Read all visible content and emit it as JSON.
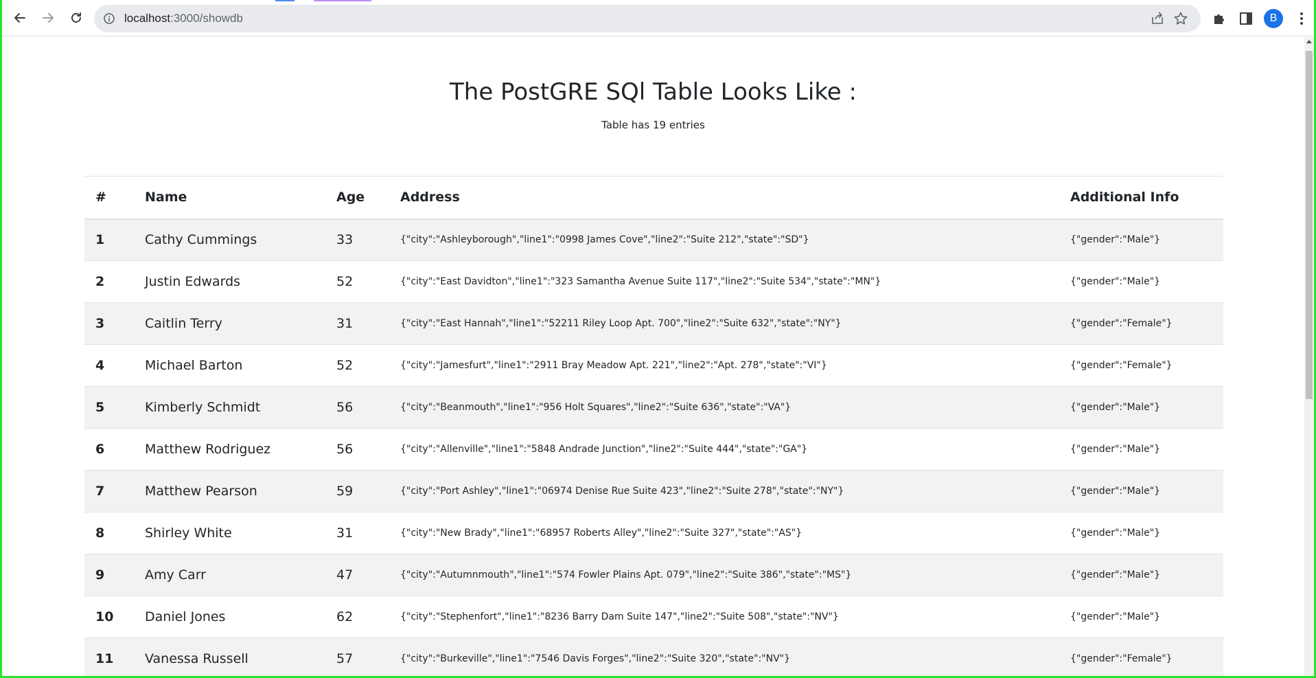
{
  "browser": {
    "url_host": "localhost",
    "url_path": ":3000/showdb",
    "avatar_letter": "B"
  },
  "page": {
    "title": "The PostGRE SQl Table Looks Like :",
    "subtitle": "Table has 19 entries"
  },
  "table": {
    "headers": [
      "#",
      "Name",
      "Age",
      "Address",
      "Additional Info"
    ],
    "rows": [
      {
        "num": "1",
        "name": "Cathy Cummings",
        "age": "33",
        "address": "{\"city\":\"Ashleyborough\",\"line1\":\"0998 James Cove\",\"line2\":\"Suite 212\",\"state\":\"SD\"}",
        "info": "{\"gender\":\"Male\"}"
      },
      {
        "num": "2",
        "name": "Justin Edwards",
        "age": "52",
        "address": "{\"city\":\"East Davidton\",\"line1\":\"323 Samantha Avenue Suite 117\",\"line2\":\"Suite 534\",\"state\":\"MN\"}",
        "info": "{\"gender\":\"Male\"}"
      },
      {
        "num": "3",
        "name": "Caitlin Terry",
        "age": "31",
        "address": "{\"city\":\"East Hannah\",\"line1\":\"52211 Riley Loop Apt. 700\",\"line2\":\"Suite 632\",\"state\":\"NY\"}",
        "info": "{\"gender\":\"Female\"}"
      },
      {
        "num": "4",
        "name": "Michael Barton",
        "age": "52",
        "address": "{\"city\":\"Jamesfurt\",\"line1\":\"2911 Bray Meadow Apt. 221\",\"line2\":\"Apt. 278\",\"state\":\"VI\"}",
        "info": "{\"gender\":\"Female\"}"
      },
      {
        "num": "5",
        "name": "Kimberly Schmidt",
        "age": "56",
        "address": "{\"city\":\"Beanmouth\",\"line1\":\"956 Holt Squares\",\"line2\":\"Suite 636\",\"state\":\"VA\"}",
        "info": "{\"gender\":\"Male\"}"
      },
      {
        "num": "6",
        "name": "Matthew Rodriguez",
        "age": "56",
        "address": "{\"city\":\"Allenville\",\"line1\":\"5848 Andrade Junction\",\"line2\":\"Suite 444\",\"state\":\"GA\"}",
        "info": "{\"gender\":\"Male\"}"
      },
      {
        "num": "7",
        "name": "Matthew Pearson",
        "age": "59",
        "address": "{\"city\":\"Port Ashley\",\"line1\":\"06974 Denise Rue Suite 423\",\"line2\":\"Suite 278\",\"state\":\"NY\"}",
        "info": "{\"gender\":\"Male\"}"
      },
      {
        "num": "8",
        "name": "Shirley White",
        "age": "31",
        "address": "{\"city\":\"New Brady\",\"line1\":\"68957 Roberts Alley\",\"line2\":\"Suite 327\",\"state\":\"AS\"}",
        "info": "{\"gender\":\"Male\"}"
      },
      {
        "num": "9",
        "name": "Amy Carr",
        "age": "47",
        "address": "{\"city\":\"Autumnmouth\",\"line1\":\"574 Fowler Plains Apt. 079\",\"line2\":\"Suite 386\",\"state\":\"MS\"}",
        "info": "{\"gender\":\"Male\"}"
      },
      {
        "num": "10",
        "name": "Daniel Jones",
        "age": "62",
        "address": "{\"city\":\"Stephenfort\",\"line1\":\"8236 Barry Dam Suite 147\",\"line2\":\"Suite 508\",\"state\":\"NV\"}",
        "info": "{\"gender\":\"Male\"}"
      },
      {
        "num": "11",
        "name": "Vanessa Russell",
        "age": "57",
        "address": "{\"city\":\"Burkeville\",\"line1\":\"7546 Davis Forges\",\"line2\":\"Suite 320\",\"state\":\"NV\"}",
        "info": "{\"gender\":\"Female\"}"
      }
    ]
  },
  "icons": {
    "back": "back-arrow-icon",
    "forward": "forward-arrow-icon",
    "reload": "reload-icon",
    "info": "info-icon",
    "share": "share-icon",
    "bookmark": "star-icon",
    "extensions": "puzzle-icon",
    "sidepanel": "side-panel-icon",
    "menu": "kebab-menu-icon"
  },
  "colors": {
    "accent_border": "#28e52b",
    "avatar_bg": "#1a73e8",
    "stripe_bg": "#f2f2f2"
  }
}
